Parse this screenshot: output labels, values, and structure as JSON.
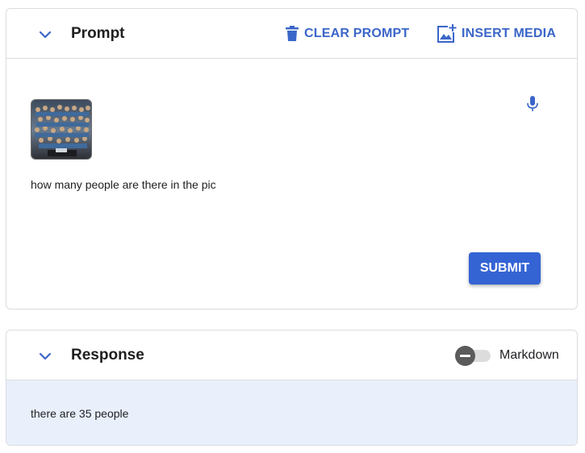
{
  "prompt_card": {
    "title": "Prompt",
    "clear_label": "CLEAR PROMPT",
    "insert_label": "INSERT MEDIA",
    "prompt_text": "how many people are there in the pic",
    "submit_label": "SUBMIT",
    "icons": {
      "collapse": "chevron-down-icon",
      "clear": "trash-icon",
      "insert": "add-photo-icon",
      "mic": "microphone-icon"
    }
  },
  "response_card": {
    "title": "Response",
    "markdown_label": "Markdown",
    "markdown_enabled": false,
    "response_text": "there are 35 people",
    "icons": {
      "collapse": "chevron-down-icon"
    }
  },
  "colors": {
    "accent": "#3b66c9",
    "submit_bg": "#3464d4",
    "response_bg": "#e9f0fb",
    "border": "#dadce0"
  }
}
